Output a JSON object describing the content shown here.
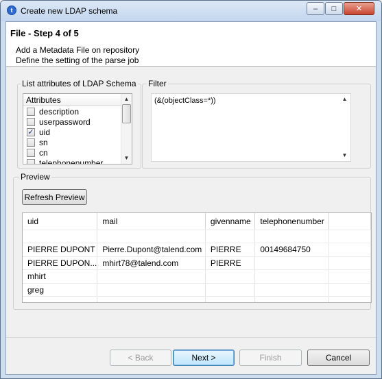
{
  "window": {
    "title": "Create new LDAP schema",
    "controls": {
      "minimize": "–",
      "maximize": "□",
      "close": "✕"
    }
  },
  "header": {
    "step_title": "File - Step 4 of 5",
    "description_line1": "Add a Metadata File on repository",
    "description_line2": "Define the setting of the parse job"
  },
  "attributes_group": {
    "label": "List attributes of LDAP Schema",
    "column_header": "Attributes",
    "items": [
      {
        "name": "description",
        "checked": false
      },
      {
        "name": "userpassword",
        "checked": false
      },
      {
        "name": "uid",
        "checked": true
      },
      {
        "name": "sn",
        "checked": false
      },
      {
        "name": "cn",
        "checked": false
      },
      {
        "name": "telephonenumber",
        "checked": false
      }
    ]
  },
  "filter_group": {
    "label": "Filter",
    "value": "(&(objectClass=*))"
  },
  "preview_group": {
    "label": "Preview",
    "refresh_label": "Refresh Preview",
    "columns": [
      "uid",
      "mail",
      "givenname",
      "telephonenumber"
    ],
    "rows": [
      [
        "",
        "",
        "",
        ""
      ],
      [
        "PIERRE DUPONT",
        "Pierre.Dupont@talend.com",
        "PIERRE",
        "00149684750"
      ],
      [
        "PIERRE DUPON...",
        "mhirt78@talend.com",
        "PIERRE",
        ""
      ],
      [
        "mhirt",
        "",
        "",
        ""
      ],
      [
        "greg",
        "",
        "",
        ""
      ],
      [
        "",
        "",
        "",
        ""
      ]
    ]
  },
  "footer": {
    "back_label": "< Back",
    "next_label": "Next >",
    "finish_label": "Finish",
    "cancel_label": "Cancel"
  }
}
